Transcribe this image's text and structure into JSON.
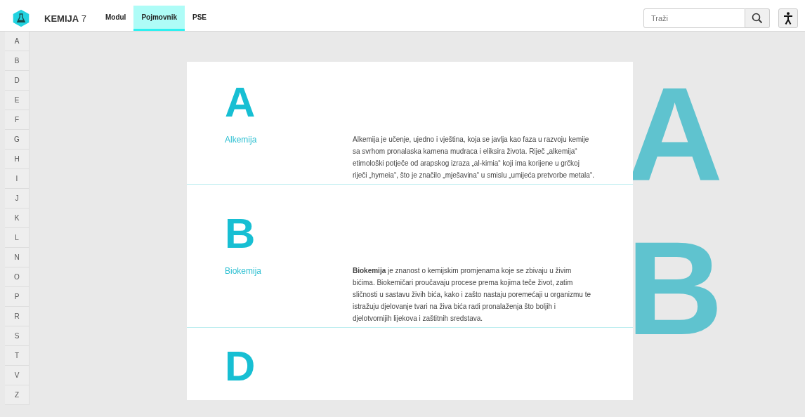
{
  "navbar": {
    "title": "KEMIJA",
    "grade": "7",
    "menu": [
      {
        "label": "Modul",
        "selected": false
      },
      {
        "label": "Pojmovnik",
        "selected": true
      },
      {
        "label": "PSE",
        "selected": false
      }
    ],
    "search": {
      "placeholder": "Traži"
    }
  },
  "alphabet": [
    {
      "label": "A"
    },
    {
      "label": "B"
    },
    {
      "label": "D"
    },
    {
      "label": "E"
    },
    {
      "label": "F"
    },
    {
      "label": "G"
    },
    {
      "label": "H"
    },
    {
      "label": "I"
    },
    {
      "label": "J"
    },
    {
      "label": "K"
    },
    {
      "label": "L"
    },
    {
      "label": "N"
    },
    {
      "label": "O"
    },
    {
      "label": "P"
    },
    {
      "label": "R"
    },
    {
      "label": "S"
    },
    {
      "label": "T"
    },
    {
      "label": "V"
    },
    {
      "label": "Z"
    }
  ],
  "sections": [
    {
      "letter": "A",
      "background_letter": "A",
      "entries": [
        {
          "term": "Alkemija",
          "definition": "Alkemija je učenje, ujedno i vještina, koja se javlja kao faza u razvoju kemije sa svrhom pronalaska kamena mudraca i eliksira života. Riječ „alkemija“ etimološki potječe od arapskog izraza „al-kimia“ koji ima korijene u grčkoj riječi „hymeia“, što je značilo „mješavina“ u smislu „umijeća pretvorbe metala“."
        }
      ]
    },
    {
      "letter": "B",
      "background_letter": "B",
      "entries": [
        {
          "term": "Biokemija",
          "definition": "**Biokemija** je znanost o kemijskim promjenama koje se zbivaju u živim bićima. Biokemičari proučavaju procese prema kojima teče život, zatim sličnosti u sastavu živih bića, kako i zašto nastaju poremećaji u organizmu te istražuju djelovanje tvari na živa bića radi pronalaženja što boljih i djelotvornijih lijekova i zaštitnih sredstava."
        }
      ]
    },
    {
      "letter": "D"
    }
  ]
}
